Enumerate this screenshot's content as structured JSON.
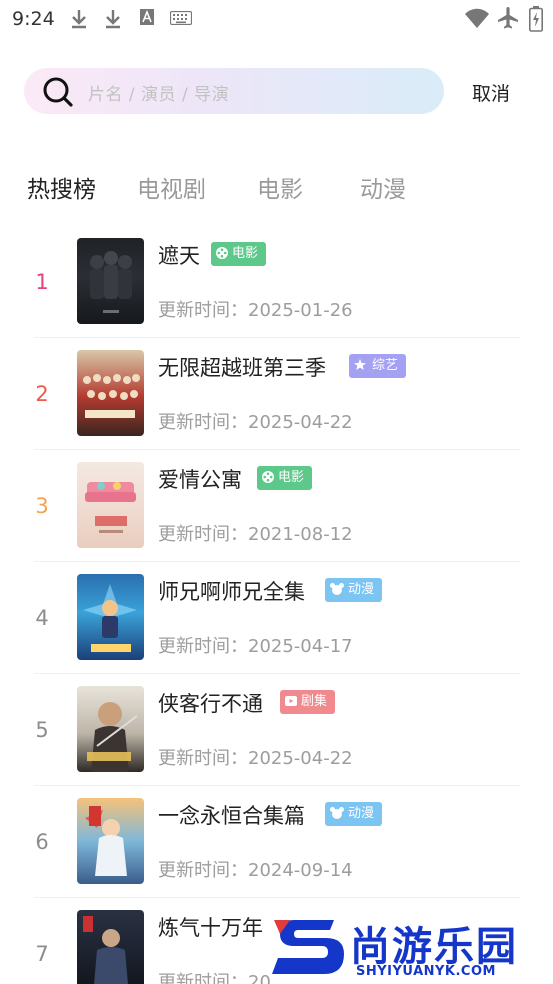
{
  "status_bar": {
    "time": "9:24"
  },
  "search": {
    "placeholder": "片名 / 演员 / 导演",
    "cancel_label": "取消"
  },
  "tabs": [
    {
      "label": "热搜榜",
      "active": true
    },
    {
      "label": "电视剧",
      "active": false
    },
    {
      "label": "电影",
      "active": false
    },
    {
      "label": "动漫",
      "active": false
    }
  ],
  "list": {
    "items": [
      {
        "rank": "1",
        "rank_color": "#e0437f",
        "title": "遮天",
        "badge": "电影",
        "badge_color": "#5cc88a",
        "badge_icon": "film-reel-icon",
        "update": "更新时间：2025-01-26"
      },
      {
        "rank": "2",
        "rank_color": "#ef5a4a",
        "title": "无限超越班第三季",
        "badge": "综艺",
        "badge_color": "#a4a1f2",
        "badge_icon": "star-icon",
        "update": "更新时间：2025-04-22"
      },
      {
        "rank": "3",
        "rank_color": "#f6a24a",
        "title": "爱情公寓",
        "badge": "电影",
        "badge_color": "#5cc88a",
        "badge_icon": "film-reel-icon",
        "update": "更新时间：2021-08-12"
      },
      {
        "rank": "4",
        "rank_color": "#8d8d8d",
        "title": "师兄啊师兄全集",
        "badge": "动漫",
        "badge_color": "#7cc4f1",
        "badge_icon": "cartoon-icon",
        "update": "更新时间：2025-04-17"
      },
      {
        "rank": "5",
        "rank_color": "#8d8d8d",
        "title": "侠客行不通",
        "badge": "剧集",
        "badge_color": "#f18a8e",
        "badge_icon": "tv-icon",
        "update": "更新时间：2025-04-22"
      },
      {
        "rank": "6",
        "rank_color": "#8d8d8d",
        "title": "一念永恒合集篇",
        "badge": "动漫",
        "badge_color": "#7cc4f1",
        "badge_icon": "cartoon-icon",
        "update": "更新时间：2024-09-14"
      },
      {
        "rank": "7",
        "rank_color": "#8d8d8d",
        "title": "炼气十万年",
        "badge": "",
        "badge_color": "#f18a8e",
        "badge_icon": "",
        "update": "更新时间：20"
      }
    ]
  },
  "watermark": {
    "name": "尚游乐园",
    "site": "SHYIYUANYK.COM",
    "color": "#1537c9"
  }
}
